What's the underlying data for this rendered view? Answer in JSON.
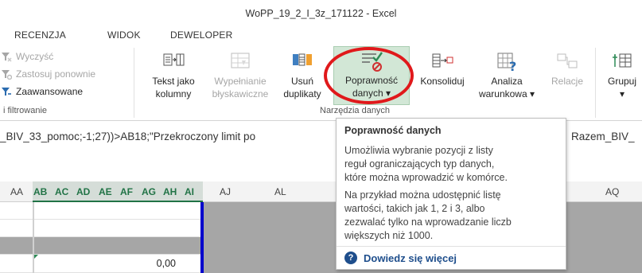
{
  "window": {
    "title": "WoPP_19_2_I_3z_171122 - Excel"
  },
  "tabs": [
    "RECENZJA",
    "WIDOK",
    "DEWELOPER"
  ],
  "ribbon": {
    "filter_group": {
      "items": [
        {
          "label": "Wyczyść",
          "icon": "clear-filter-icon",
          "enabled": false
        },
        {
          "label": "Zastosuj ponownie",
          "icon": "reapply-icon",
          "enabled": false
        },
        {
          "label": "Zaawansowane",
          "icon": "advanced-filter-icon",
          "enabled": true
        }
      ],
      "label": "i filtrowanie"
    },
    "data_tools_group": {
      "label": "Narzędzia danych",
      "buttons": [
        {
          "line1": "Tekst jako",
          "line2": "kolumny",
          "icon": "text-to-columns-icon",
          "enabled": true
        },
        {
          "line1": "Wypełnianie",
          "line2": "błyskawiczne",
          "icon": "flash-fill-icon",
          "enabled": false
        },
        {
          "line1": "Usuń",
          "line2": "duplikaty",
          "icon": "remove-duplicates-icon",
          "enabled": true
        },
        {
          "line1": "Poprawność",
          "line2": "danych",
          "dropdown": "▾",
          "icon": "data-validation-icon",
          "enabled": true,
          "active": true
        },
        {
          "line1": "Konsoliduj",
          "line2": "",
          "icon": "consolidate-icon",
          "enabled": true
        },
        {
          "line1": "Analiza",
          "line2": "warunkowa",
          "dropdown": "▾",
          "icon": "what-if-analysis-icon",
          "enabled": true
        },
        {
          "line1": "Relacje",
          "line2": "",
          "icon": "relationships-icon",
          "enabled": false
        },
        {
          "line1": "Grupuj",
          "line2": "",
          "dropdown": "▾",
          "icon": "group-icon",
          "enabled": true
        }
      ]
    }
  },
  "formula_bar": {
    "left": "_BIV_33_pomoc;-1;27))>AB18;\"Przekroczony limit po",
    "right": "Razem_BIV_"
  },
  "grid": {
    "columns": [
      "AA",
      "AB",
      "AC",
      "AD",
      "AE",
      "AF",
      "AG",
      "AH",
      "AI",
      "AJ",
      "AL",
      "AQ"
    ],
    "selected_columns": [
      "AB",
      "AC",
      "AD",
      "AE",
      "AF",
      "AG",
      "AH",
      "AI"
    ],
    "cell_value": "0,00"
  },
  "tooltip": {
    "title": "Poprawność danych",
    "paragraph1": [
      "Umożliwia wybranie pozycji z listy",
      "reguł ograniczających typ danych,",
      "które można wprowadzić w komórce."
    ],
    "paragraph2": [
      "Na przykład można udostępnić listę",
      "wartości, takich jak 1, 2 i 3, albo",
      "zezwalać tylko na wprowadzanie liczb",
      "większych niż 1000."
    ],
    "link": "Dowiedz się więcej",
    "link_icon": "help-circle-icon"
  },
  "colors": {
    "excel_green": "#217346",
    "highlight_red": "#e0191b",
    "selection_blue": "#0000cc",
    "link_blue": "#1e4e8c"
  }
}
